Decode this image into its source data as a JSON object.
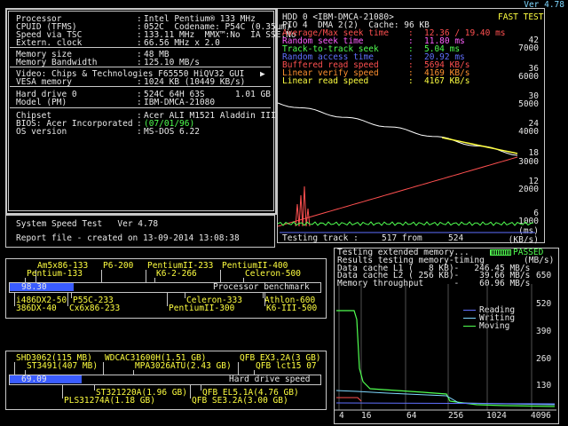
{
  "version": "Ver 4.78",
  "sysinfo": {
    "rows": [
      {
        "k": "Processor",
        "v": "Intel Pentium® 133 MHz"
      },
      {
        "k": "CPUID (TFMS)",
        "v": "052C  Codename: P54C (0.35µm)"
      },
      {
        "k": "Speed via TSC",
        "v": "133.11 MHz  MMX™:No  IA SSE:No"
      },
      {
        "k": "Extern. clock",
        "v": "66.56 MHz x 2.0"
      }
    ],
    "mem": [
      {
        "k": "Memory size",
        "v": "48 MB"
      },
      {
        "k": "Memory Bandwidth",
        "v": "125.10 MB/s"
      }
    ],
    "video": [
      {
        "k": "Video: Chips & Technologies F65550 HiQV32 GUI",
        "v": ""
      },
      {
        "k": "VESA memory",
        "v": "1024 KB (10449 KB/s)"
      }
    ],
    "hdd": [
      {
        "k": "Hard drive 0",
        "v": "524C 64H 63S      1.01 GB"
      },
      {
        "k": "Model (PM)",
        "v": "IBM-DMCA-21080"
      }
    ],
    "chipset": [
      {
        "k": "Chipset",
        "v": "Acer ALI M1521 Aladdin III"
      },
      {
        "k": "BIOS: Acer Incorporated",
        "v": "(07/01/96)"
      },
      {
        "k": "OS version",
        "v": "MS-DOS 6.22"
      }
    ],
    "speedtest": "System Speed Test   Ver 4.78",
    "report": "Report file - created on 13-09-2014 13:08:38"
  },
  "hdd_panel": {
    "header1": "HDD 0 <IBM-DMCA-21080>",
    "fast_test": "FAST TEST",
    "header2": "PIO 4  DMA 2(2)  Cache: 96 KB",
    "stats": [
      {
        "label": "Average/Max seek time",
        "value": "12.36 / 19.40 ms",
        "color": "#ff5050"
      },
      {
        "label": "Random seek time",
        "value": "11.80 ms",
        "color": "#ff60ff"
      },
      {
        "label": "Track-to-track seek",
        "value": "5.04 ms",
        "color": "#50ff50"
      },
      {
        "label": "Random access time",
        "value": "20.92 ms",
        "color": "#6070ff"
      },
      {
        "label": "Buffered read speed",
        "value": "5694 KB/s",
        "color": "#ff5050"
      },
      {
        "label": "Linear verify speed",
        "value": "4169 KB/s",
        "color": "#ff9030"
      },
      {
        "label": "Linear read speed",
        "value": "4167 KB/s",
        "color": "#ffff40"
      }
    ],
    "right_axis": [
      "42",
      "7000",
      "36",
      "6000",
      "30",
      "5000",
      "24",
      "4000",
      "18",
      "3000",
      "12",
      "2000",
      "6",
      "1000",
      "(ms)",
      "(KB/s)"
    ],
    "testing_label": "Testing track :",
    "track_from": "517 from",
    "track_total": "524"
  },
  "mem_panel": {
    "line1": "Testing extended memory...",
    "passed": "PASSED",
    "line2": "Results testing memory-timing",
    "units": "(MB/s)",
    "l1": "Data cache L1 (   8 KB)-   246.45 MB/s",
    "l2": "Data cache L2 ( 256 KB)-    39.66 MB/s",
    "thru": "Memory throughput      -    60.96 MB/s",
    "y_axis": [
      "650",
      "520",
      "390",
      "260",
      "130"
    ],
    "x_axis": [
      "4",
      "16",
      "64",
      "256",
      "1024",
      "4096"
    ],
    "legend": [
      {
        "name": "Reading",
        "color": "#6070ff"
      },
      {
        "name": "Writing",
        "color": "#7fd8ff"
      },
      {
        "name": "Moving",
        "color": "#50ff50"
      }
    ]
  },
  "cpu_bench": {
    "score": "98.30",
    "label": "Processor benchmark",
    "fill": 0.205,
    "top_names": [
      {
        "t": "Am5x86-133",
        "c": "#ffff40"
      },
      {
        "t": "P6-200",
        "c": "#ffff40"
      },
      {
        "t": "PentiumII-233",
        "c": "#ffff40"
      },
      {
        "t": "PentiumII-400",
        "c": "#ffff40"
      },
      {
        "t": "Pentium-133",
        "c": "#ffff40"
      },
      {
        "t": "K6-2-266",
        "c": "#ffff40"
      },
      {
        "t": "Celeron-500",
        "c": "#ffff40"
      }
    ],
    "bottom_names": [
      {
        "t": "i486DX2-50",
        "c": "#ffff40"
      },
      {
        "t": "P55C-233",
        "c": "#ffff40"
      },
      {
        "t": "Celeron-333",
        "c": "#ffff40"
      },
      {
        "t": "Athlon-600",
        "c": "#ffff40"
      },
      {
        "t": "386DX-40",
        "c": "#ffff40"
      },
      {
        "t": "Cx6x86-233",
        "c": "#ffff40"
      },
      {
        "t": "PentiumII-300",
        "c": "#ffff40"
      },
      {
        "t": "K6-III-500",
        "c": "#ffff40"
      }
    ]
  },
  "hdd_bench": {
    "score": "69.09",
    "label": "Hard drive speed",
    "fill": 0.23,
    "top_names": [
      {
        "t": "SHD3062(115 MB)"
      },
      {
        "t": "WDCAC31600H(1.51 GB)"
      },
      {
        "t": "QFB EX3.2A(3 GB)"
      },
      {
        "t": "ST3491(407 MB)"
      },
      {
        "t": "MPA3026ATU(2.43 GB)"
      },
      {
        "t": "QFB lct15 07"
      }
    ],
    "bottom_names": [
      {
        "t": "ST321220A(1.96 GB)"
      },
      {
        "t": "QFB EL5.1A(4.76 GB)"
      },
      {
        "t": "PLS31274A(1.18 GB)"
      },
      {
        "t": "QFB SE3.2A(3.00 GB)"
      }
    ]
  }
}
